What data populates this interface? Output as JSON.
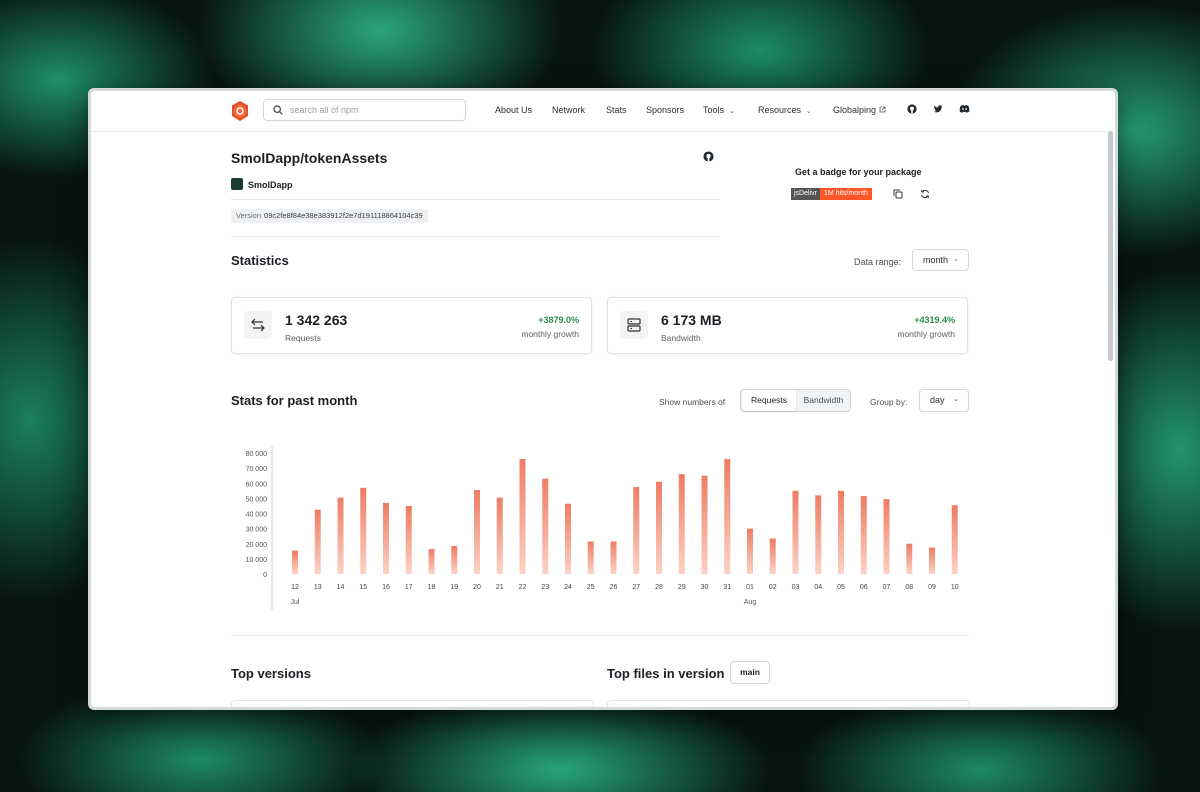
{
  "header": {
    "search_placeholder": "search all of npm",
    "nav": [
      "About Us",
      "Network",
      "Stats",
      "Sponsors",
      "Tools",
      "Resources",
      "Globalping"
    ]
  },
  "package": {
    "title": "SmolDapp/tokenAssets",
    "author": "SmolDapp",
    "version_label": "Version",
    "version_hash": "09c2fe8f84e38e383912f2e7d191118864104c39"
  },
  "badge": {
    "title": "Get a badge for your package",
    "left": "jsDelivr",
    "right": "1M hits/month"
  },
  "statistics": {
    "title": "Statistics",
    "range_label": "Data range:",
    "range_value": "month",
    "requests": {
      "value": "1 342 263",
      "label": "Requests",
      "growth": "+3879.0%",
      "growth_label": "monthly growth"
    },
    "bandwidth": {
      "value": "6 173 MB",
      "label": "Bandwidth",
      "growth": "+4319.4%",
      "growth_label": "monthly growth"
    }
  },
  "past_month": {
    "title": "Stats for past month",
    "show_label": "Show numbers of",
    "toggle": [
      "Requests",
      "Bandwidth"
    ],
    "group_label": "Group by:",
    "group_value": "day"
  },
  "chart_data": {
    "type": "bar",
    "categories": [
      "12",
      "13",
      "14",
      "15",
      "16",
      "17",
      "18",
      "19",
      "20",
      "21",
      "22",
      "23",
      "24",
      "25",
      "26",
      "27",
      "28",
      "29",
      "30",
      "31",
      "01",
      "02",
      "03",
      "04",
      "05",
      "06",
      "07",
      "08",
      "09",
      "10"
    ],
    "month_labels": [
      {
        "index": 0,
        "label": "Jul"
      },
      {
        "index": 20,
        "label": "Aug"
      }
    ],
    "values": [
      15500,
      42500,
      50500,
      57000,
      47000,
      45000,
      16500,
      18500,
      55500,
      50500,
      76000,
      63000,
      46500,
      21500,
      21500,
      57500,
      61000,
      66000,
      65000,
      76000,
      30000,
      23500,
      55000,
      52000,
      55000,
      51500,
      49500,
      20000,
      17500,
      45500
    ],
    "yticks": [
      "0",
      "10 000",
      "20 000",
      "30 000",
      "40 000",
      "50 000",
      "60 000",
      "70 000",
      "80 000"
    ],
    "ylim": [
      0,
      80000
    ],
    "colors": {
      "top": "#ef7c63",
      "bottom": "#fbd2c5"
    }
  },
  "bottom": {
    "top_versions": "Top versions",
    "top_files": "Top files in version",
    "branch": "main"
  }
}
